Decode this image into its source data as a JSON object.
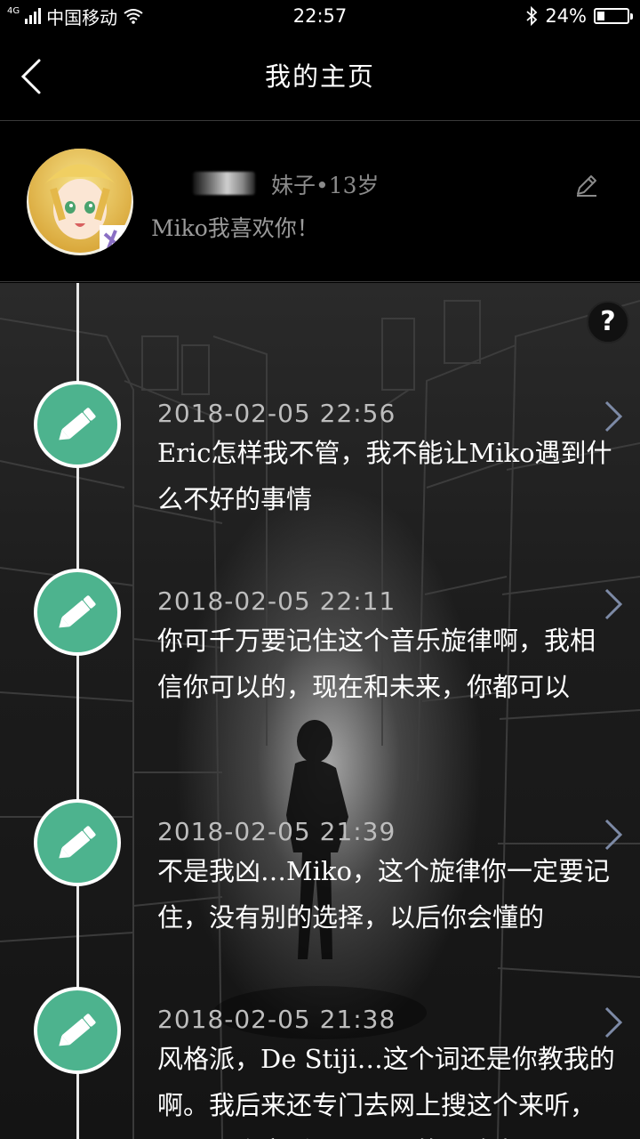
{
  "status_bar": {
    "network": "4G",
    "carrier": "中国移动",
    "time": "22:57",
    "battery": "24%",
    "battery_level": 0.24,
    "icons": [
      "signal-icon",
      "wifi-icon",
      "bluetooth-icon",
      "battery-icon"
    ]
  },
  "nav": {
    "title": "我的主页",
    "back_icon": "chevron-left-icon"
  },
  "profile": {
    "meta": "妹子•13岁",
    "bio": "Miko我喜欢你！",
    "edit_icon": "pencil-icon"
  },
  "help": {
    "label": "?"
  },
  "entries": [
    {
      "time": "2018-02-05 22:56",
      "text": "Eric怎样我不管，我不能让Miko遇到什么不好的事情"
    },
    {
      "time": "2018-02-05 22:11",
      "text": "你可千万要记住这个音乐旋律啊，我相信你可以的，现在和未来，你都可以"
    },
    {
      "time": "2018-02-05 21:39",
      "text": "不是我凶…Miko，这个旋律你一定要记住，没有别的选择，以后你会懂的"
    },
    {
      "time": "2018-02-05 21:38",
      "text": "风格派，De Stiji…这个词还是你教我的啊。我后来还专门去网上搜这个来听，嗯，那个音乐页面下面的评论真"
    }
  ],
  "colors": {
    "node": "#4db38e",
    "background": "#000000",
    "muted_text": "#8a8a8a"
  }
}
